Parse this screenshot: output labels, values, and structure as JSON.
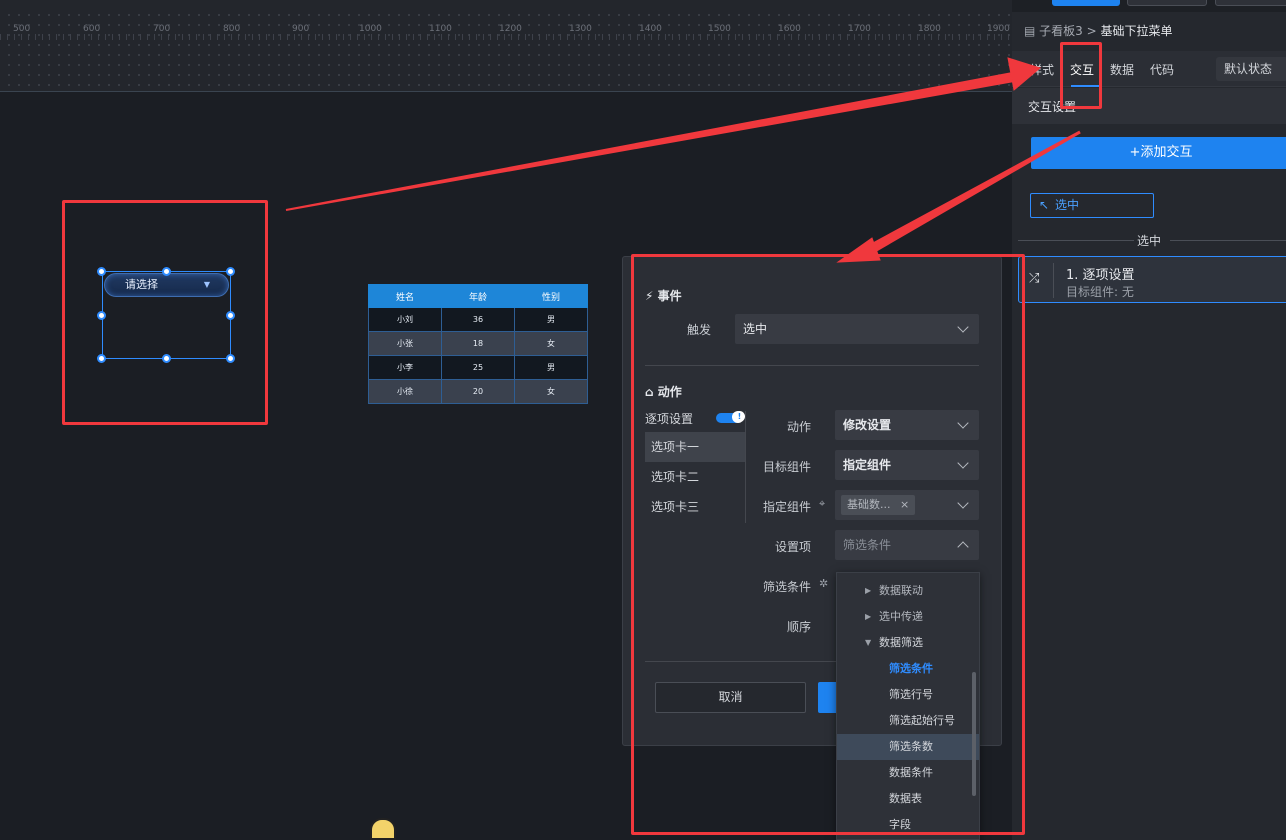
{
  "ruler": {
    "ticks": [
      "500",
      "600",
      "700",
      "800",
      "900",
      "1000",
      "1100",
      "1200",
      "1300",
      "1400",
      "1500",
      "1600",
      "1700",
      "1800",
      "1900"
    ]
  },
  "canvas": {
    "dropdown_component": {
      "placeholder": "请选择",
      "arrow": "▼"
    },
    "table": {
      "headers": [
        "姓名",
        "年龄",
        "性别"
      ],
      "rows": [
        [
          "小刘",
          "36",
          "男"
        ],
        [
          "小张",
          "18",
          "女"
        ],
        [
          "小李",
          "25",
          "男"
        ],
        [
          "小徐",
          "20",
          "女"
        ]
      ]
    }
  },
  "right_panel": {
    "breadcrumb": {
      "parent": "子看板3",
      "separator": ">",
      "current": "基础下拉菜单"
    },
    "tabs": [
      "样式",
      "交互",
      "数据",
      "代码"
    ],
    "active_tab": "交互",
    "state_select": "默认状态",
    "section_title": "交互设置",
    "add_button": "+添加交互",
    "event_tag": "选中",
    "divider_label": "选中",
    "action_card": {
      "title": "1. 逐项设置",
      "subtitle": "目标组件: 无"
    }
  },
  "modal": {
    "event_section": "事件",
    "trigger_label": "触发",
    "trigger_value": "选中",
    "action_section": "动作",
    "item_setting_label": "逐项设置",
    "cards": [
      "选项卡一",
      "选项卡二",
      "选项卡三"
    ],
    "active_card": "选项卡一",
    "action_label": "动作",
    "action_value": "修改设置",
    "target_label": "目标组件",
    "target_value": "指定组件",
    "specify_label": "指定组件",
    "specify_chip": "基础数...",
    "setting_label": "设置项",
    "setting_placeholder": "筛选条件",
    "filter_label": "筛选条件",
    "order_label": "顺序",
    "cancel_button": "取消"
  },
  "dropdown_list": {
    "items": [
      {
        "label": "数据联动",
        "type": "parent-collapsed"
      },
      {
        "label": "选中传递",
        "type": "parent-collapsed"
      },
      {
        "label": "数据筛选",
        "type": "parent-expanded"
      },
      {
        "label": "筛选条件",
        "type": "child-selected"
      },
      {
        "label": "筛选行号",
        "type": "child"
      },
      {
        "label": "筛选起始行号",
        "type": "child"
      },
      {
        "label": "筛选条数",
        "type": "child-hover"
      },
      {
        "label": "数据条件",
        "type": "child"
      },
      {
        "label": "数据表",
        "type": "child"
      },
      {
        "label": "字段",
        "type": "child"
      }
    ]
  },
  "colors": {
    "accent": "#1e83f0",
    "annotation": "#f0383d",
    "panel": "#25282e",
    "canvas": "#1b1e24"
  }
}
